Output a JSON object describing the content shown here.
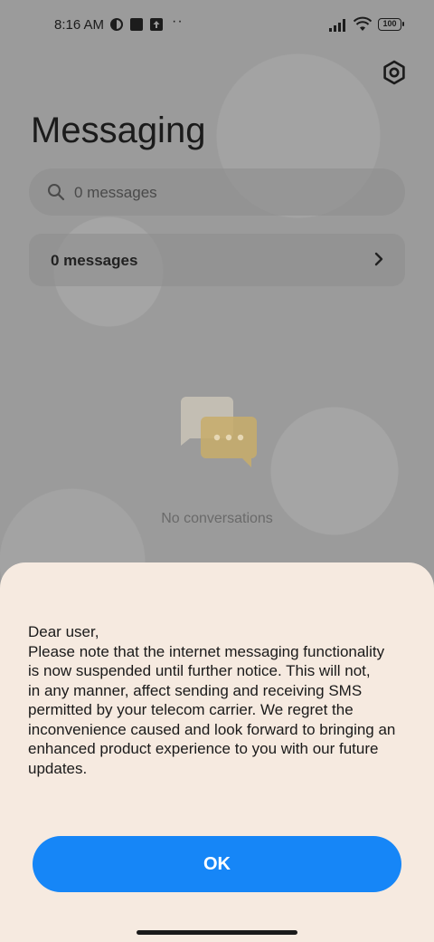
{
  "status_bar": {
    "time": "8:16 AM",
    "notification_dots": "··",
    "battery": "100"
  },
  "header": {
    "title": "Messaging",
    "settings_icon": "gear-hexagon-icon"
  },
  "search": {
    "placeholder": "0 messages",
    "icon": "search-icon"
  },
  "group_row": {
    "label": "0 messages"
  },
  "empty_state": {
    "text": "No conversations"
  },
  "dialog": {
    "lines": [
      "Dear user,",
      "Please note that the internet messaging functionality",
      "is now suspended until further notice. This will not,",
      "in any manner, affect sending and receiving SMS",
      "permitted by your telecom carrier. We regret the",
      "inconvenience caused and look forward to bringing an",
      "enhanced product experience to you with our future",
      "updates."
    ],
    "ok_label": "OK"
  },
  "colors": {
    "accent": "#1686f7",
    "sheet_bg": "#f6eae0"
  }
}
